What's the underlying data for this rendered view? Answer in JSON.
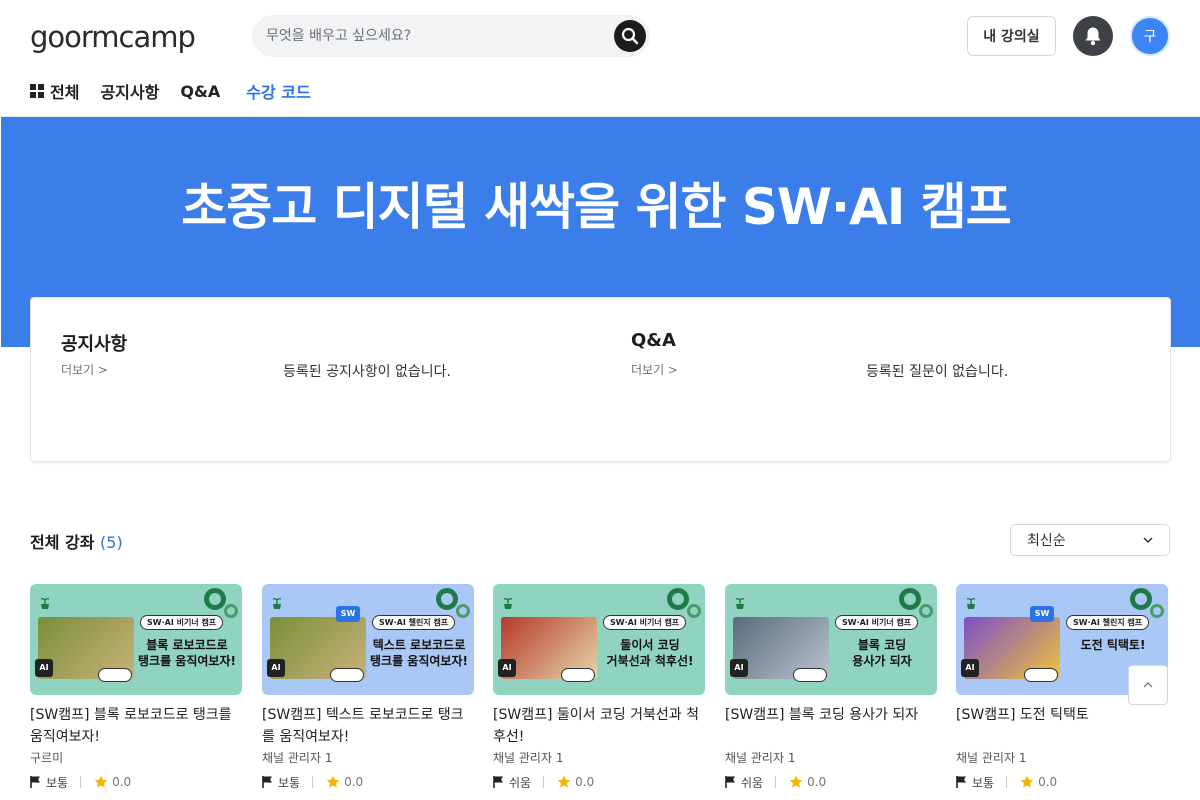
{
  "header": {
    "logo": "goormcamp",
    "search_placeholder": "무엇을 배우고 싶으세요?",
    "my_courses": "내 강의실",
    "avatar_initial": "구"
  },
  "nav": {
    "all": "전체",
    "notice": "공지사항",
    "qna": "Q&A",
    "enroll_code": "수강 코드"
  },
  "banner": {
    "title": "초중고 디지털 새싹을 위한 SW·AI 캠프",
    "color": "#3b7de9"
  },
  "board": {
    "notice": {
      "title": "공지사항",
      "more": "더보기  >",
      "empty": "등록된 공지사항이 없습니다."
    },
    "qna": {
      "title": "Q&A",
      "more": "더보기  >",
      "empty": "등록된 질문이 없습니다."
    }
  },
  "courses": {
    "heading": "전체 강좌",
    "count": "(5)",
    "sort": "최신순",
    "items": [
      {
        "title": "[SW캠프] 블록 로보코드로 탱크를 움직여보자!",
        "author": "구르미",
        "level": "보통",
        "rating": "0.0",
        "thumb_bg": "#8fd3c0",
        "thumb_tag": "SW·AI 비기너 캠프",
        "thumb_text": "블록 로보코드로\n탱크를 움직여보자!"
      },
      {
        "title": "[SW캠프] 텍스트 로보코드로 탱크를 움직여보자!",
        "author": "채널 관리자 1",
        "level": "보통",
        "rating": "0.0",
        "thumb_bg": "#a9c8f5",
        "thumb_tag": "SW·AI 챌린지 캠프",
        "thumb_text": "텍스트 로보코드로\n탱크를 움직여보자!"
      },
      {
        "title": "[SW캠프] 둘이서 코딩 거북선과 척후선!",
        "author": "채널 관리자 1",
        "level": "쉬움",
        "rating": "0.0",
        "thumb_bg": "#8fd3c0",
        "thumb_tag": "SW·AI 비기너 캠프",
        "thumb_text": "둘이서 코딩\n거북선과 척후선!"
      },
      {
        "title": "[SW캠프] 블록 코딩 용사가 되자",
        "author": "채널 관리자 1",
        "level": "쉬움",
        "rating": "0.0",
        "thumb_bg": "#8fd3c0",
        "thumb_tag": "SW·AI 비기너 캠프",
        "thumb_text": "블록 코딩\n용사가 되자"
      },
      {
        "title": "[SW캠프] 도전 틱택토",
        "author": "채널 관리자 1",
        "level": "보통",
        "rating": "0.0",
        "thumb_bg": "#a9c8f5",
        "thumb_tag": "SW·AI 챌린지 캠프",
        "thumb_text": "도전 틱택토!"
      }
    ]
  },
  "icons": {
    "search": "search-icon",
    "bell": "bell-icon",
    "grid": "grid-icon",
    "chevron": "chevron-down-icon",
    "flag": "flag-icon",
    "star": "star-icon",
    "scroll_top": "chevron-up-icon"
  },
  "colors": {
    "accent": "#2b72e6",
    "star": "#f5b400"
  }
}
